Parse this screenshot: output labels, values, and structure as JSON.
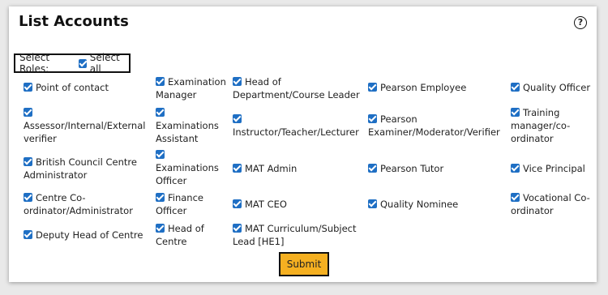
{
  "page": {
    "title": "List Accounts",
    "help_icon": "?",
    "submit_label": "Submit"
  },
  "roles": {
    "label": "Select Roles:",
    "select_all": "Select all"
  },
  "options": [
    "Point of contact",
    "Examination Manager",
    "Head of Department/Course Leader",
    "Pearson Employee",
    "Quality Officer",
    "Assessor/Internal/External verifier",
    "Examinations Assistant",
    "Instructor/Teacher/Lecturer",
    "Pearson Examiner/Moderator/Verifier",
    "Training manager/co-ordinator",
    "British Council Centre Administrator",
    "Examinations Officer",
    "MAT Admin",
    "Pearson Tutor",
    "Vice Principal",
    "Centre Co-ordinator/Administrator",
    "Finance Officer",
    "MAT CEO",
    "Quality Nominee",
    "Vocational Co-ordinator",
    "Deputy Head of Centre",
    "Head of Centre",
    "MAT Curriculum/Subject Lead [HE1]"
  ]
}
